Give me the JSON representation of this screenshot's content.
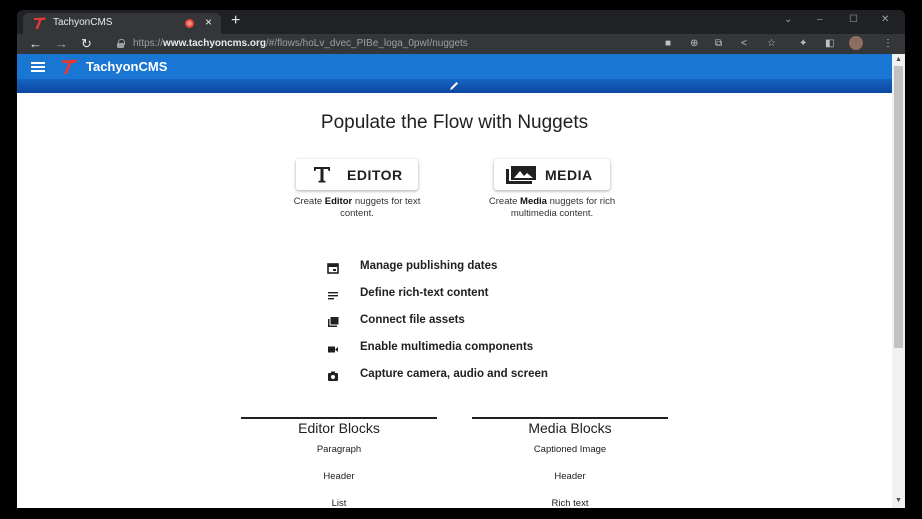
{
  "browser": {
    "tab_title": "TachyonCMS",
    "tab_close": "×",
    "new_tab": "+",
    "url_prefix": "https://",
    "url_host": "www.tachyoncms.org",
    "url_path": "/#/flows/hoLv_dvec_PIBe_loga_0pwI/nuggets",
    "window_controls": [
      "⌄",
      "–",
      "☐",
      "✕"
    ]
  },
  "app": {
    "title": "TachyonCMS",
    "brand_color": "#1976d2",
    "logo_color": "#e53935"
  },
  "main": {
    "heading": "Populate the Flow with Nuggets",
    "editor_button": "EDITOR",
    "editor_desc_pre": "Create ",
    "editor_desc_bold": "Editor",
    "editor_desc_post": " nuggets for text content.",
    "media_button": "MEDIA",
    "media_desc_pre": "Create ",
    "media_desc_bold": "Media",
    "media_desc_post": " nuggets for rich multimedia content.",
    "features": [
      {
        "icon": "calendar-icon",
        "label": "Manage publishing dates"
      },
      {
        "icon": "text-lines-icon",
        "label": "Define rich-text content"
      },
      {
        "icon": "file-assets-icon",
        "label": "Connect file assets"
      },
      {
        "icon": "video-camera-icon",
        "label": "Enable multimedia components"
      },
      {
        "icon": "camera-icon",
        "label": "Capture camera, audio and screen"
      }
    ],
    "editor_blocks": {
      "title": "Editor Blocks",
      "items": [
        "Paragraph",
        "Header",
        "List"
      ]
    },
    "media_blocks": {
      "title": "Media Blocks",
      "items": [
        "Captioned Image",
        "Header",
        "Rich text"
      ]
    }
  }
}
